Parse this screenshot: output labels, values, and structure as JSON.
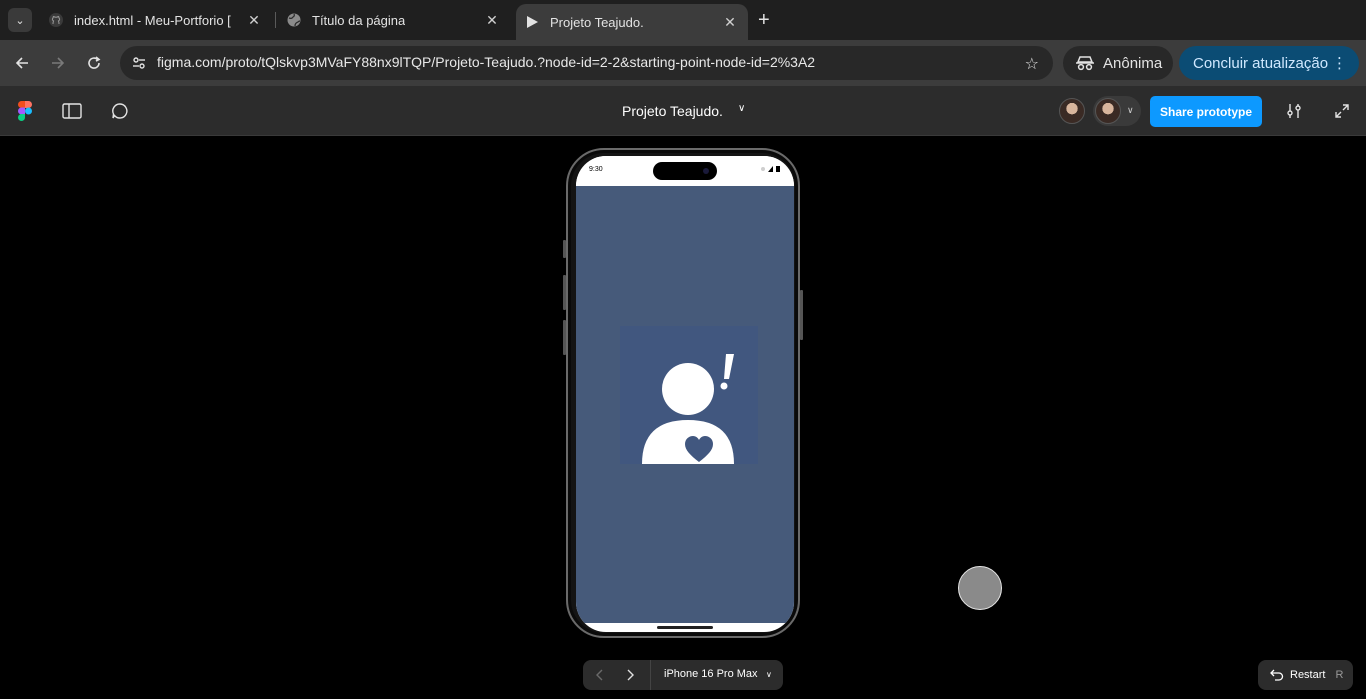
{
  "browser": {
    "tabs": [
      {
        "title": "index.html - Meu-Portforio [",
        "icon": "github-icon",
        "active": false
      },
      {
        "title": "Título da página",
        "icon": "globe-icon",
        "active": false
      },
      {
        "title": "Projeto Teajudo.",
        "icon": "play-icon",
        "active": true
      }
    ],
    "url": "figma.com/proto/tQlskvp3MVaFY88nx9lTQP/Projeto-Teajudo.?node-id=2-2&starting-point-node-id=2%3A2",
    "profile_label": "Anônima",
    "update_label": "Concluir atualização"
  },
  "figma": {
    "project_title": "Projeto Teajudo.",
    "share_label": "Share prototype"
  },
  "phone": {
    "time": "9:30",
    "screen_color": "#465a7a",
    "logo_bg": "#41577f"
  },
  "prototype_nav": {
    "device": "iPhone 16 Pro Max"
  },
  "restart": {
    "label": "Restart",
    "shortcut": "R"
  },
  "colors": {
    "share_button": "#0d99ff",
    "update_button": "#0b4c74"
  }
}
